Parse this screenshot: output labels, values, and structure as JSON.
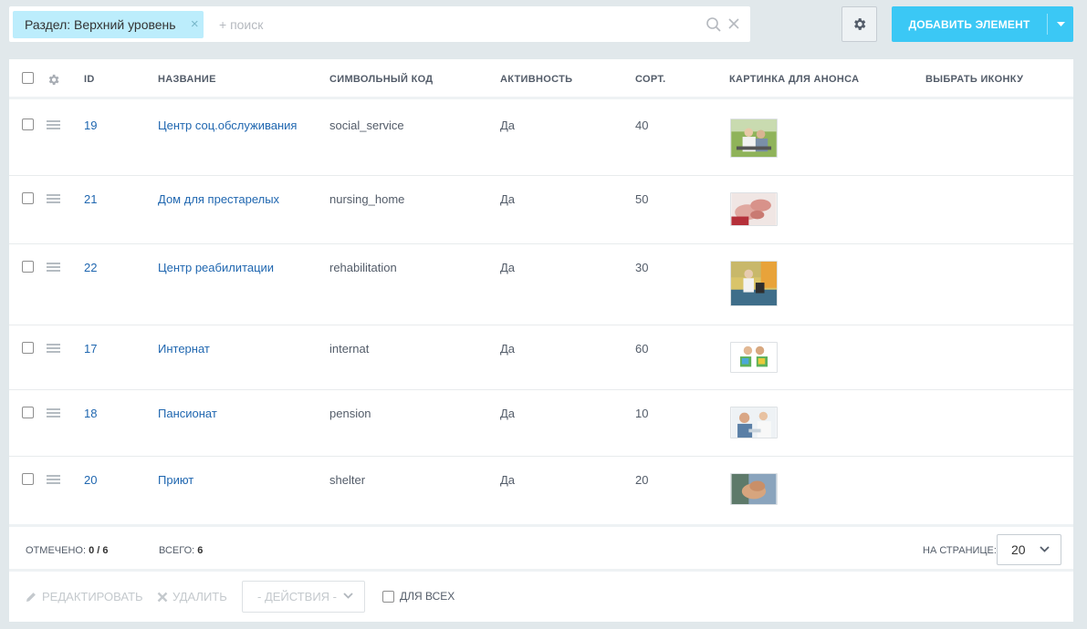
{
  "filter": {
    "tag_label": "Раздел: Верхний уровень",
    "tag_remove": "×",
    "search_placeholder": "+ поиск"
  },
  "toolbar": {
    "add_label": "ДОБАВИТЬ ЭЛЕМЕНТ",
    "accent": "#3bc8f5"
  },
  "grid": {
    "columns": {
      "id": "ID",
      "name": "НАЗВАНИЕ",
      "code": "СИМВОЛЬНЫЙ КОД",
      "active": "АКТИВНОСТЬ",
      "sort": "СОРТ.",
      "picture": "КАРТИНКА ДЛЯ АНОНСА",
      "icon": "ВЫБРАТЬ ИКОНКУ"
    },
    "rows": [
      {
        "id": "19",
        "name": "Центр соц.обслуживания",
        "code": "social_service",
        "active": "Да",
        "sort": "40",
        "thumb": "photo-elderly-care"
      },
      {
        "id": "21",
        "name": "Дом для престарелых",
        "code": "nursing_home",
        "active": "Да",
        "sort": "50",
        "thumb": "photo-holding-hands"
      },
      {
        "id": "22",
        "name": "Центр реабилитации",
        "code": "rehabilitation",
        "active": "Да",
        "sort": "30",
        "thumb": "photo-rehabilitation"
      },
      {
        "id": "17",
        "name": "Интернат",
        "code": "internat",
        "active": "Да",
        "sort": "60",
        "thumb": "photo-children-letters"
      },
      {
        "id": "18",
        "name": "Пансионат",
        "code": "pension",
        "active": "Да",
        "sort": "10",
        "thumb": "photo-doctor-patient"
      },
      {
        "id": "20",
        "name": "Приют",
        "code": "shelter",
        "active": "Да",
        "sort": "20",
        "thumb": "photo-hands"
      }
    ]
  },
  "footer": {
    "selected_label": "ОТМЕЧЕНО:",
    "selected_value": "0 / 6",
    "total_label": "ВСЕГО:",
    "total_value": "6",
    "per_page_label": "НА СТРАНИЦЕ:",
    "per_page_value": "20"
  },
  "actions": {
    "edit": "РЕДАКТИРОВАТЬ",
    "delete": "УДАЛИТЬ",
    "actions_select": "- ДЕЙСТВИЯ -",
    "for_all": "ДЛЯ ВСЕХ"
  }
}
